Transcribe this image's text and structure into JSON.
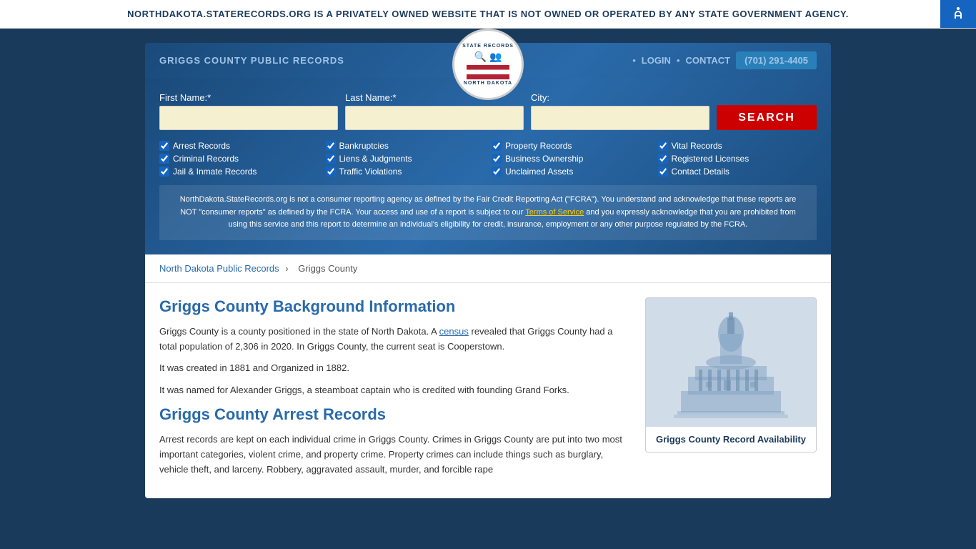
{
  "banner": {
    "text": "NORTHDAKOTA.STATERECORDS.ORG IS A PRIVATELY OWNED WEBSITE THAT IS NOT OWNED OR OPERATED BY ANY STATE GOVERNMENT AGENCY.",
    "close_label": "×"
  },
  "header": {
    "site_title": "GRIGGS COUNTY PUBLIC RECORDS",
    "logo": {
      "top_text": "STATE RECORDS",
      "bottom_text": "NORTH DAKOTA"
    },
    "nav": {
      "login_label": "LOGIN",
      "contact_label": "CONTACT",
      "phone": "(701) 291-4405",
      "dot": "•"
    }
  },
  "search": {
    "first_name_label": "First Name:*",
    "last_name_label": "Last Name:*",
    "city_label": "City:",
    "search_button_label": "SEARCH",
    "checkboxes": [
      {
        "label": "Arrest Records",
        "checked": true
      },
      {
        "label": "Bankruptcies",
        "checked": true
      },
      {
        "label": "Property Records",
        "checked": true
      },
      {
        "label": "Vital Records",
        "checked": true
      },
      {
        "label": "Criminal Records",
        "checked": true
      },
      {
        "label": "Liens & Judgments",
        "checked": true
      },
      {
        "label": "Business Ownership",
        "checked": true
      },
      {
        "label": "Registered Licenses",
        "checked": true
      },
      {
        "label": "Jail & Inmate Records",
        "checked": true
      },
      {
        "label": "Traffic Violations",
        "checked": true
      },
      {
        "label": "Unclaimed Assets",
        "checked": true
      },
      {
        "label": "Contact Details",
        "checked": true
      }
    ],
    "disclaimer": "NorthDakota.StateRecords.org is not a consumer reporting agency as defined by the Fair Credit Reporting Act (\"FCRA\"). You understand and acknowledge that these reports are NOT \"consumer reports\" as defined by the FCRA. Your access and use of a report is subject to our Terms of Service and you expressly acknowledge that you are prohibited from using this service and this report to determine an individual's eligibility for credit, insurance, employment or any other purpose regulated by the FCRA.",
    "terms_link": "Terms of Service"
  },
  "breadcrumb": {
    "link_text": "North Dakota Public Records",
    "separator": "›",
    "current": "Griggs County"
  },
  "main": {
    "bg_title": "Griggs County Background Information",
    "bg_paragraphs": [
      "Griggs County is a county positioned in the state of North Dakota. A census revealed that Griggs County had a total population of 2,306 in 2020. In Griggs County, the current seat is Cooperstown.",
      "It was created in 1881 and Organized in 1882.",
      "It was named for Alexander Griggs, a steamboat captain who is credited with founding Grand Forks."
    ],
    "census_link": "census",
    "arrest_title": "Griggs County Arrest Records",
    "arrest_paragraph": "Arrest records are kept on each individual crime in Griggs County. Crimes in Griggs County are put into two most important categories, violent crime, and property crime. Property crimes can include things such as burglary, vehicle theft, and larceny. Robbery, aggravated assault, murder, and forcible rape"
  },
  "sidebar": {
    "caption": "Griggs County Record Availability"
  }
}
